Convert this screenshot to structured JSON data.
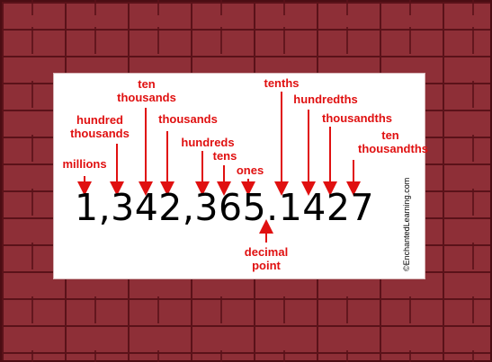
{
  "labels": {
    "millions": "millions",
    "hundred_thousands": "hundred\nthousands",
    "ten_thousands": "ten\nthousands",
    "thousands": "thousands",
    "hundreds": "hundreds",
    "tens": "tens",
    "ones": "ones",
    "tenths": "tenths",
    "hundredths": "hundredths",
    "thousandths": "thousandths",
    "ten_thousandths": "ten\nthousandths",
    "decimal_point": "decimal\npoint"
  },
  "number": "1,342,365.1427",
  "credit": "©EnchantedLearning.com",
  "colors": {
    "label": "#e01010",
    "arrow": "#e01010",
    "brick": "#8e2f37",
    "mortar": "#5a1219",
    "panel": "#ffffff"
  }
}
